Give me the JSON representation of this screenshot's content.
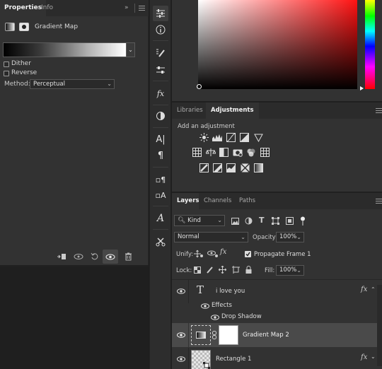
{
  "properties": {
    "tabs": [
      "Properties",
      "Info"
    ],
    "header_title": "Gradient Map",
    "dither_label": "Dither",
    "reverse_label": "Reverse",
    "method_label": "Method:",
    "method_value": "Perceptual"
  },
  "adjustments": {
    "tabs": [
      "Libraries",
      "Adjustments"
    ],
    "add_label": "Add an adjustment"
  },
  "layers": {
    "tabs": [
      "Layers",
      "Channels",
      "Paths"
    ],
    "filter_kind": "Kind",
    "blend_mode": "Normal",
    "opacity_label": "Opacity:",
    "opacity_value": "100%",
    "unify_label": "Unify:",
    "propagate_label": "Propagate Frame 1",
    "lock_label": "Lock:",
    "fill_label": "Fill:",
    "fill_value": "100%",
    "items": [
      {
        "name": "i love you",
        "type": "text",
        "fx": "fx"
      },
      {
        "name": "Effects",
        "type": "effects-group"
      },
      {
        "name": "Drop Shadow",
        "type": "effect"
      },
      {
        "name": "Gradient Map 2",
        "type": "adjustment"
      },
      {
        "name": "Rectangle 1",
        "type": "shape",
        "fx": "fx"
      }
    ]
  },
  "colors": {
    "panel_bg": "#323232",
    "tab_bar_bg": "#2b2b2b",
    "selected_layer_bg": "#4a4a4a"
  }
}
